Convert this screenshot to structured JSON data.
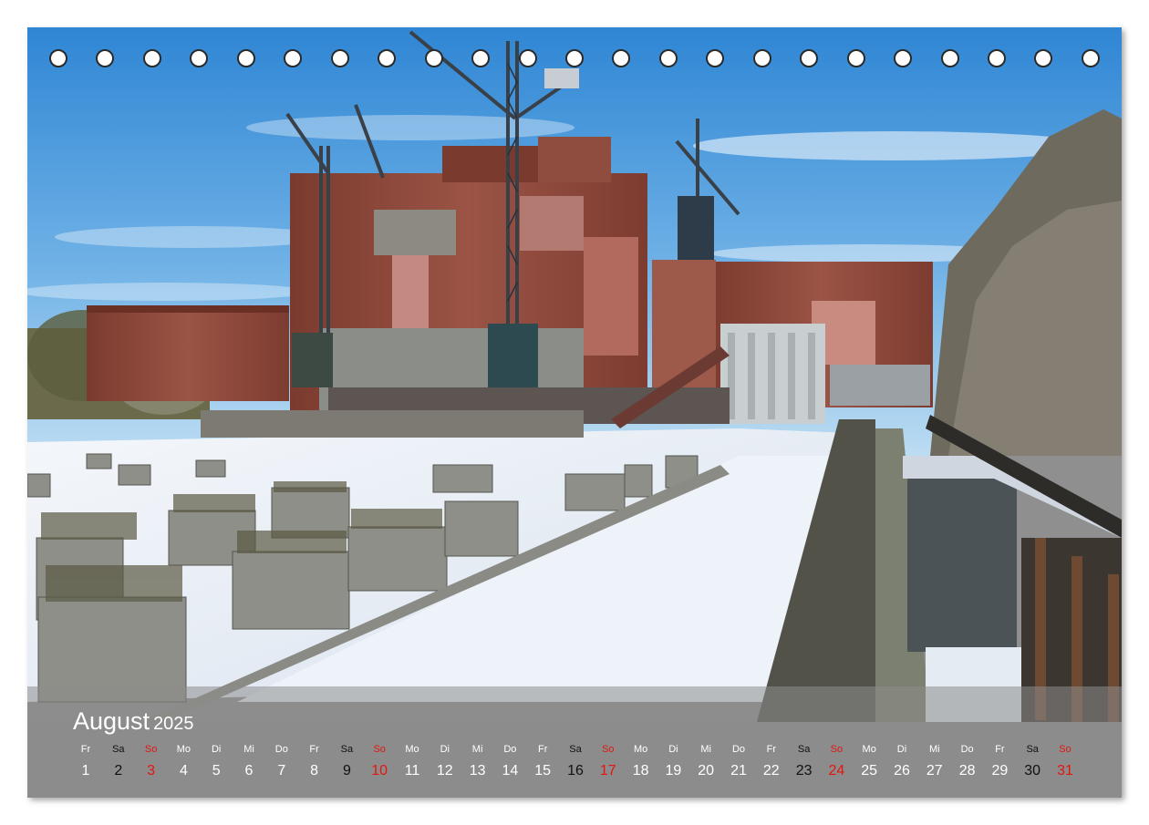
{
  "calendar": {
    "month": "August",
    "year": "2025",
    "days": [
      {
        "name": "Fr",
        "num": "1",
        "type": "weekday"
      },
      {
        "name": "Sa",
        "num": "2",
        "type": "sat"
      },
      {
        "name": "So",
        "num": "3",
        "type": "sun"
      },
      {
        "name": "Mo",
        "num": "4",
        "type": "weekday"
      },
      {
        "name": "Di",
        "num": "5",
        "type": "weekday"
      },
      {
        "name": "Mi",
        "num": "6",
        "type": "weekday"
      },
      {
        "name": "Do",
        "num": "7",
        "type": "weekday"
      },
      {
        "name": "Fr",
        "num": "8",
        "type": "weekday"
      },
      {
        "name": "Sa",
        "num": "9",
        "type": "sat"
      },
      {
        "name": "So",
        "num": "10",
        "type": "sun"
      },
      {
        "name": "Mo",
        "num": "11",
        "type": "weekday"
      },
      {
        "name": "Di",
        "num": "12",
        "type": "weekday"
      },
      {
        "name": "Mi",
        "num": "13",
        "type": "weekday"
      },
      {
        "name": "Do",
        "num": "14",
        "type": "weekday"
      },
      {
        "name": "Fr",
        "num": "15",
        "type": "weekday"
      },
      {
        "name": "Sa",
        "num": "16",
        "type": "sat"
      },
      {
        "name": "So",
        "num": "17",
        "type": "sun"
      },
      {
        "name": "Mo",
        "num": "18",
        "type": "weekday"
      },
      {
        "name": "Di",
        "num": "19",
        "type": "weekday"
      },
      {
        "name": "Mi",
        "num": "20",
        "type": "weekday"
      },
      {
        "name": "Do",
        "num": "21",
        "type": "weekday"
      },
      {
        "name": "Fr",
        "num": "22",
        "type": "weekday"
      },
      {
        "name": "Sa",
        "num": "23",
        "type": "sat"
      },
      {
        "name": "So",
        "num": "24",
        "type": "sun"
      },
      {
        "name": "Mo",
        "num": "25",
        "type": "weekday"
      },
      {
        "name": "Di",
        "num": "26",
        "type": "weekday"
      },
      {
        "name": "Mi",
        "num": "27",
        "type": "weekday"
      },
      {
        "name": "Do",
        "num": "28",
        "type": "weekday"
      },
      {
        "name": "Fr",
        "num": "29",
        "type": "weekday"
      },
      {
        "name": "Sa",
        "num": "30",
        "type": "sat"
      },
      {
        "name": "So",
        "num": "31",
        "type": "sun"
      }
    ]
  },
  "colors": {
    "sunday": "#e3160f",
    "saturday": "#111111",
    "weekday": "#ffffff",
    "footer": "#8c8c8c"
  },
  "binding_holes": 23
}
